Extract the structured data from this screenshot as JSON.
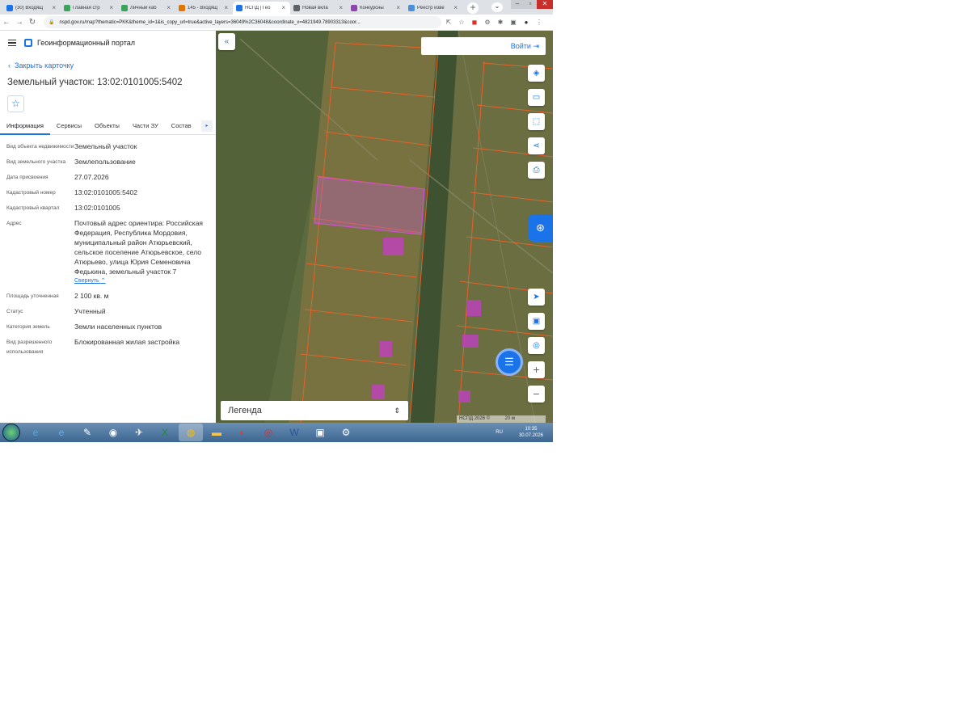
{
  "browser": {
    "tabs": [
      {
        "title": "(30) Входящ",
        "color": "#1a73e8"
      },
      {
        "title": "Главная стр",
        "color": "#3aa55a"
      },
      {
        "title": "Личный каб",
        "color": "#3aa55a"
      },
      {
        "title": "145 - Входящ",
        "color": "#e37400"
      },
      {
        "title": "НСПД | Гео",
        "color": "#1a73e8",
        "active": true
      },
      {
        "title": "Новая вкла",
        "color": "#5f6368"
      },
      {
        "title": "Конкурсны",
        "color": "#8e44ad"
      },
      {
        "title": "Реестр изве",
        "color": "#4a90d9"
      }
    ],
    "url": "nspd.gov.ru/map?thematic=PKK&theme_id=1&is_copy_url=true&active_layers=36049%2C36048&coordinate_x=4821949.78903313&coor..."
  },
  "panel": {
    "portal_title": "Геоинформационный портал",
    "close_label": "Закрыть карточку",
    "title": "Земельный участок: 13:02:0101005:5402",
    "tabs": [
      "Информация",
      "Сервисы",
      "Объекты",
      "Части ЗУ",
      "Состав"
    ],
    "properties": [
      {
        "key": "Вид объекта недвижимости",
        "value": "Земельный участок"
      },
      {
        "key": "Вид земельного участка",
        "value": "Землепользование"
      },
      {
        "key": "Дата присвоения",
        "value": "27.07.2026"
      },
      {
        "key": "Кадастровый номер",
        "value": "13:02:0101005:5402"
      },
      {
        "key": "Кадастровый квартал",
        "value": "13:02:0101005"
      },
      {
        "key": "Адрес",
        "value": "Почтовый адрес ориентира: Российская Федерация, Республика Мордовия, муниципальный район Атюрьевский, сельское поселение Атюрьевское, село Атюрьево, улица Юрия Семеновича Федькина, земельный участок 7"
      },
      {
        "key": "Площадь уточненная",
        "value": "2 100 кв. м"
      },
      {
        "key": "Статус",
        "value": "Учтенный"
      },
      {
        "key": "Категория земель",
        "value": "Земли населенных пунктов"
      },
      {
        "key": "Вид разрешенного использования",
        "value": "Блокированная жилая застройка"
      }
    ],
    "collapse_label": "Свернуть"
  },
  "map": {
    "login_label": "Войти",
    "legend_label": "Легенда",
    "attribution": "НСПД 2026 ©",
    "scale": "20 м"
  },
  "taskbar": {
    "lang": "RU",
    "time": "10:35",
    "date": "30.07.2026"
  }
}
